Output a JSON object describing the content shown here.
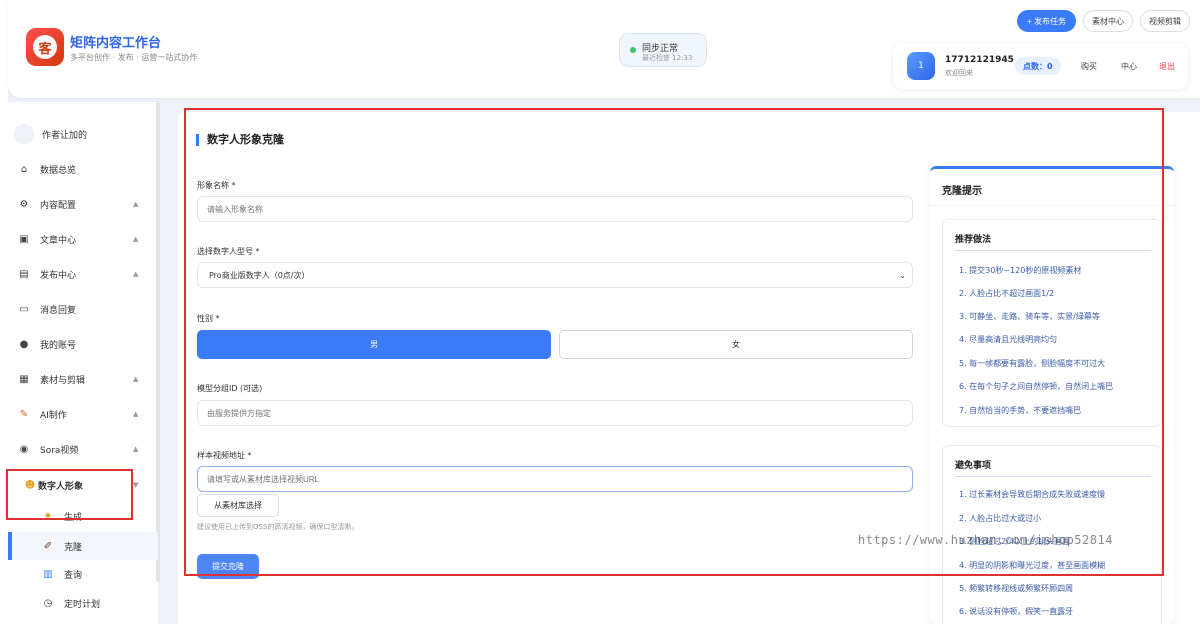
{
  "header": {
    "brand_title": "矩阵内容工作台",
    "brand_subtitle": "多平台创作 · 发布 · 运营一站式协作",
    "logo_char": "客",
    "sync_status": "同步正常",
    "sync_time": "最近检查 12:33",
    "publish_task_label": "+ 发布任务",
    "material_center_label": "素材中心",
    "video_edit_label": "视频剪辑"
  },
  "user": {
    "avatar_text": "1",
    "phone": "17712121945",
    "welcome": "欢迎回来",
    "points": "点数：0",
    "buy_label": "购买",
    "center_label": "中心",
    "logout_label": "退出"
  },
  "sidebar": {
    "items": [
      {
        "label": "作者让加的",
        "icon": "blank-avatar-icon"
      },
      {
        "label": "数据总览",
        "icon": "home-icon"
      },
      {
        "label": "内容配置",
        "icon": "settings-icon",
        "arrow": "▲"
      },
      {
        "label": "文章中心",
        "icon": "article-icon",
        "arrow": "▲"
      },
      {
        "label": "发布中心",
        "icon": "publish-icon",
        "arrow": "▲"
      },
      {
        "label": "消息回复",
        "icon": "message-icon"
      },
      {
        "label": "我的账号",
        "icon": "account-icon"
      },
      {
        "label": "素材与剪辑",
        "icon": "material-icon",
        "arrow": "▲"
      },
      {
        "label": "AI制作",
        "icon": "ai-icon",
        "arrow": "▲"
      },
      {
        "label": "Sora视频",
        "icon": "sora-icon",
        "arrow": "▲"
      },
      {
        "label": "数字人形象",
        "icon": "digital-human-icon",
        "arrow": "▼"
      }
    ],
    "subitems": [
      {
        "label": "生成",
        "icon": "generate-icon"
      },
      {
        "label": "克隆",
        "icon": "clone-icon"
      },
      {
        "label": "查询",
        "icon": "query-icon"
      },
      {
        "label": "定时计划",
        "icon": "timer-icon"
      }
    ]
  },
  "form": {
    "title": "数字人形象克隆",
    "name_label": "形象名称 *",
    "name_placeholder": "请输入形象名称",
    "model_label": "选择数字人型号 *",
    "model_value": "Pro商业版数字人（0点/次）",
    "gender_label": "性别 *",
    "gender_male": "男",
    "gender_female": "女",
    "group_label": "模型分组ID (可选)",
    "group_placeholder": "由服务提供方指定",
    "video_label": "样本视频地址 *",
    "video_placeholder": "请填写或从素材库选择视频URL",
    "library_button": "从素材库选择",
    "help_text": "建议使用已上传到OSS的高清视频，确保口型清晰。",
    "submit_label": "提交克隆"
  },
  "tips": {
    "title": "克隆提示",
    "recommended_title": "推荐做法",
    "recommended": [
      "1. 提交30秒~120秒的原视频素材",
      "2. 人脸占比不超过画面1/2",
      "3. 可静坐、走路、骑车等，实景/绿幕等",
      "4. 尽量高清且光线明亮均匀",
      "5. 每一帧都要有露脸，侧脸幅度不可过大",
      "6. 在每个句子之间自然停顿，自然闭上嘴巴",
      "7. 自然恰当的手势，不要遮挡嘴巴"
    ],
    "avoid_title": "避免事项",
    "avoid": [
      "1. 过长素材会导致后期合成失败或速度慢",
      "2. 人脸占比过大或过小",
      "3. 侧脸超过2/4以上的镜头画面",
      "4. 明显的阴影和曝光过度，甚至画面模糊",
      "5. 频繁转移视线或频繁环顾四周",
      "6. 说话没有停顿，假笑一直露牙"
    ]
  },
  "watermark": "https://www.huzhan.com/ishop52814",
  "colors": {
    "accent": "#3a7bfa",
    "highlight_box": "#e03131",
    "logout": "#e5484d"
  }
}
